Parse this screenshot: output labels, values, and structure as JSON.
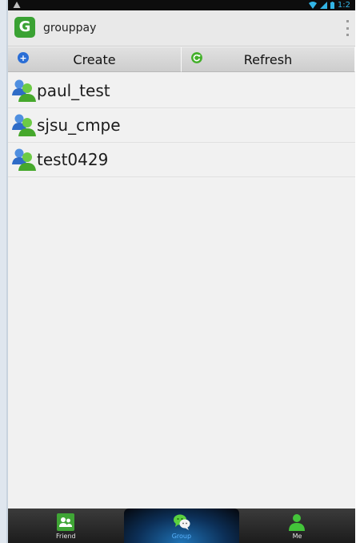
{
  "status_bar": {
    "time": "1:2"
  },
  "action_bar": {
    "app_logo_letter": "G",
    "title": "grouppay"
  },
  "buttons": {
    "create": {
      "label": "Create",
      "icon": "plus-icon",
      "color": "#2a6ed6"
    },
    "refresh": {
      "label": "Refresh",
      "icon": "refresh-icon",
      "color": "#43b02a"
    }
  },
  "groups": [
    {
      "name": "paul_test",
      "icon": "group-icon"
    },
    {
      "name": "sjsu_cmpe",
      "icon": "group-icon"
    },
    {
      "name": "test0429",
      "icon": "group-icon"
    }
  ],
  "bottom_nav": {
    "items": [
      {
        "label": "Friend",
        "icon": "friend-icon",
        "active": false
      },
      {
        "label": "Group",
        "icon": "group-chat-icon",
        "active": true
      },
      {
        "label": "Me",
        "icon": "person-icon",
        "active": false
      }
    ]
  },
  "colors": {
    "accent_green": "#3aa233",
    "active_tab": "#5ab4ff",
    "status_blue": "#33b5e5"
  }
}
